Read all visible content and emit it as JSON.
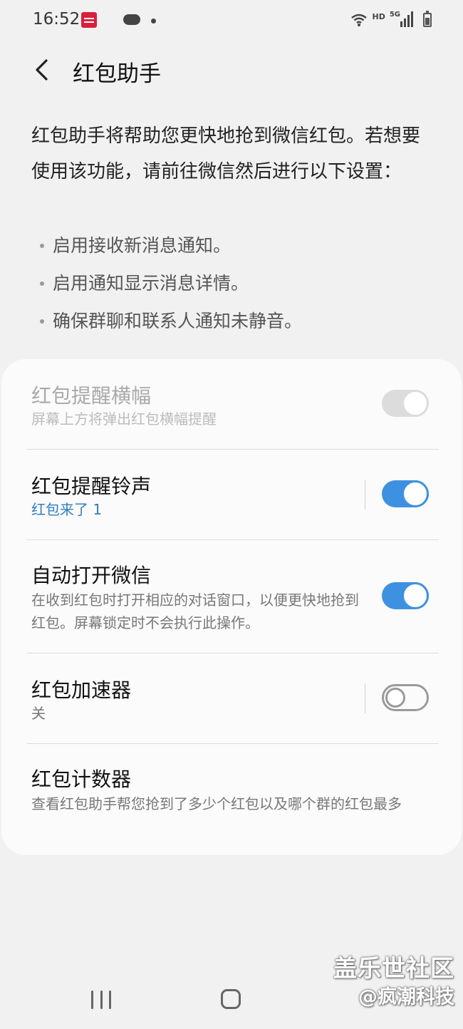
{
  "status_bar": {
    "time": "16:52",
    "hd_label": "HD",
    "network_label": "5G",
    "icons": [
      "app-notification-icon",
      "cloud-icon",
      "dot-icon",
      "wifi-icon",
      "signal-icon",
      "battery-icon"
    ]
  },
  "header": {
    "title": "红包助手",
    "back_icon": "chevron-left-icon"
  },
  "intro": {
    "text": "红包助手将帮助您更快地抢到微信红包。若想要使用该功能，请前往微信然后进行以下设置：",
    "bullets": [
      "启用接收新消息通知。",
      "启用通知显示消息详情。",
      "确保群聊和联系人通知未静音。"
    ]
  },
  "settings": [
    {
      "title": "红包提醒横幅",
      "subtitle": "屏幕上方将弹出红包横幅提醒",
      "toggle": "on",
      "enabled": false
    },
    {
      "title": "红包提醒铃声",
      "subtitle": "红包来了 1",
      "toggle": "on",
      "enabled": true
    },
    {
      "title": "自动打开微信",
      "subtitle": "在收到红包时打开相应的对话窗口，以便更快地抢到红包。屏幕锁定时不会执行此操作。",
      "toggle": "on",
      "enabled": true
    },
    {
      "title": "红包加速器",
      "subtitle": "关",
      "toggle": "off",
      "enabled": true
    },
    {
      "title": "红包计数器",
      "subtitle": "查看红包助手帮您抢到了多少个红包以及哪个群的红包最多"
    }
  ],
  "watermark": {
    "line1": "盖乐世社区",
    "line2": "@疯潮科技"
  },
  "colors": {
    "background": "#f1f1f1",
    "card": "#fbfbfb",
    "accent": "#3e91e1",
    "link": "#2f7fc1",
    "notification_icon": "#d8203c"
  }
}
